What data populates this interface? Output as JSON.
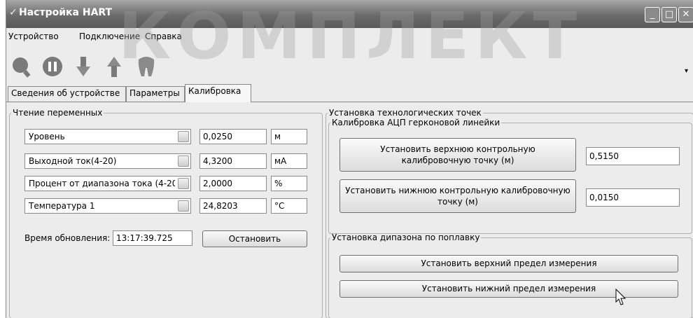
{
  "window": {
    "title": "Настройка HART",
    "minimize_label": "_",
    "maximize_label": "□",
    "close_label": "✕"
  },
  "watermark": "КОМПЛЕКТ",
  "menu": {
    "items": [
      "Устройство",
      "Подключение",
      "Справка"
    ]
  },
  "toolbar": {
    "icons": [
      "search-icon",
      "pause-icon",
      "download-icon",
      "upload-icon",
      "tooth-icon"
    ],
    "overflow_label": "▾"
  },
  "tabs": [
    {
      "label": "Сведения об устройстве"
    },
    {
      "label": "Параметры"
    },
    {
      "label": "Калибровка"
    }
  ],
  "reading": {
    "legend": "Чтение переменных",
    "rows": [
      {
        "variable": "Уровень",
        "value": "0,0250",
        "unit": "м"
      },
      {
        "variable": "Выходной ток(4-20)",
        "value": "4,3200",
        "unit": "мА"
      },
      {
        "variable": "Процент от диапазона тока (4-20",
        "value": "2,0000",
        "unit": "%"
      },
      {
        "variable": "Температура 1",
        "value": "24,8203",
        "unit": "°C"
      }
    ],
    "update_time_label": "Время обновления:",
    "update_time_value": "13:17:39.725",
    "stop_button": "Остановить"
  },
  "tech_points": {
    "legend": "Установка технологических точек",
    "adc": {
      "legend": "Калибровка АЦП герконовой линейки",
      "upper_button": "Установить верхнюю контрольную калибровочную точку (м)",
      "upper_value": "0,5150",
      "lower_button": "Установить нижнюю контрольную калибровочную точку (м)",
      "lower_value": "0,0150"
    },
    "float_range": {
      "legend": "Установка дипазона по поплавку",
      "upper_button": "Установить верхний предел измерения",
      "lower_button": "Установить нижний предел измерения"
    }
  },
  "colors": {
    "titlebar": "#6a6a6a",
    "window_bg": "#ececec",
    "toolbar_icon": "#7a7a7a"
  }
}
